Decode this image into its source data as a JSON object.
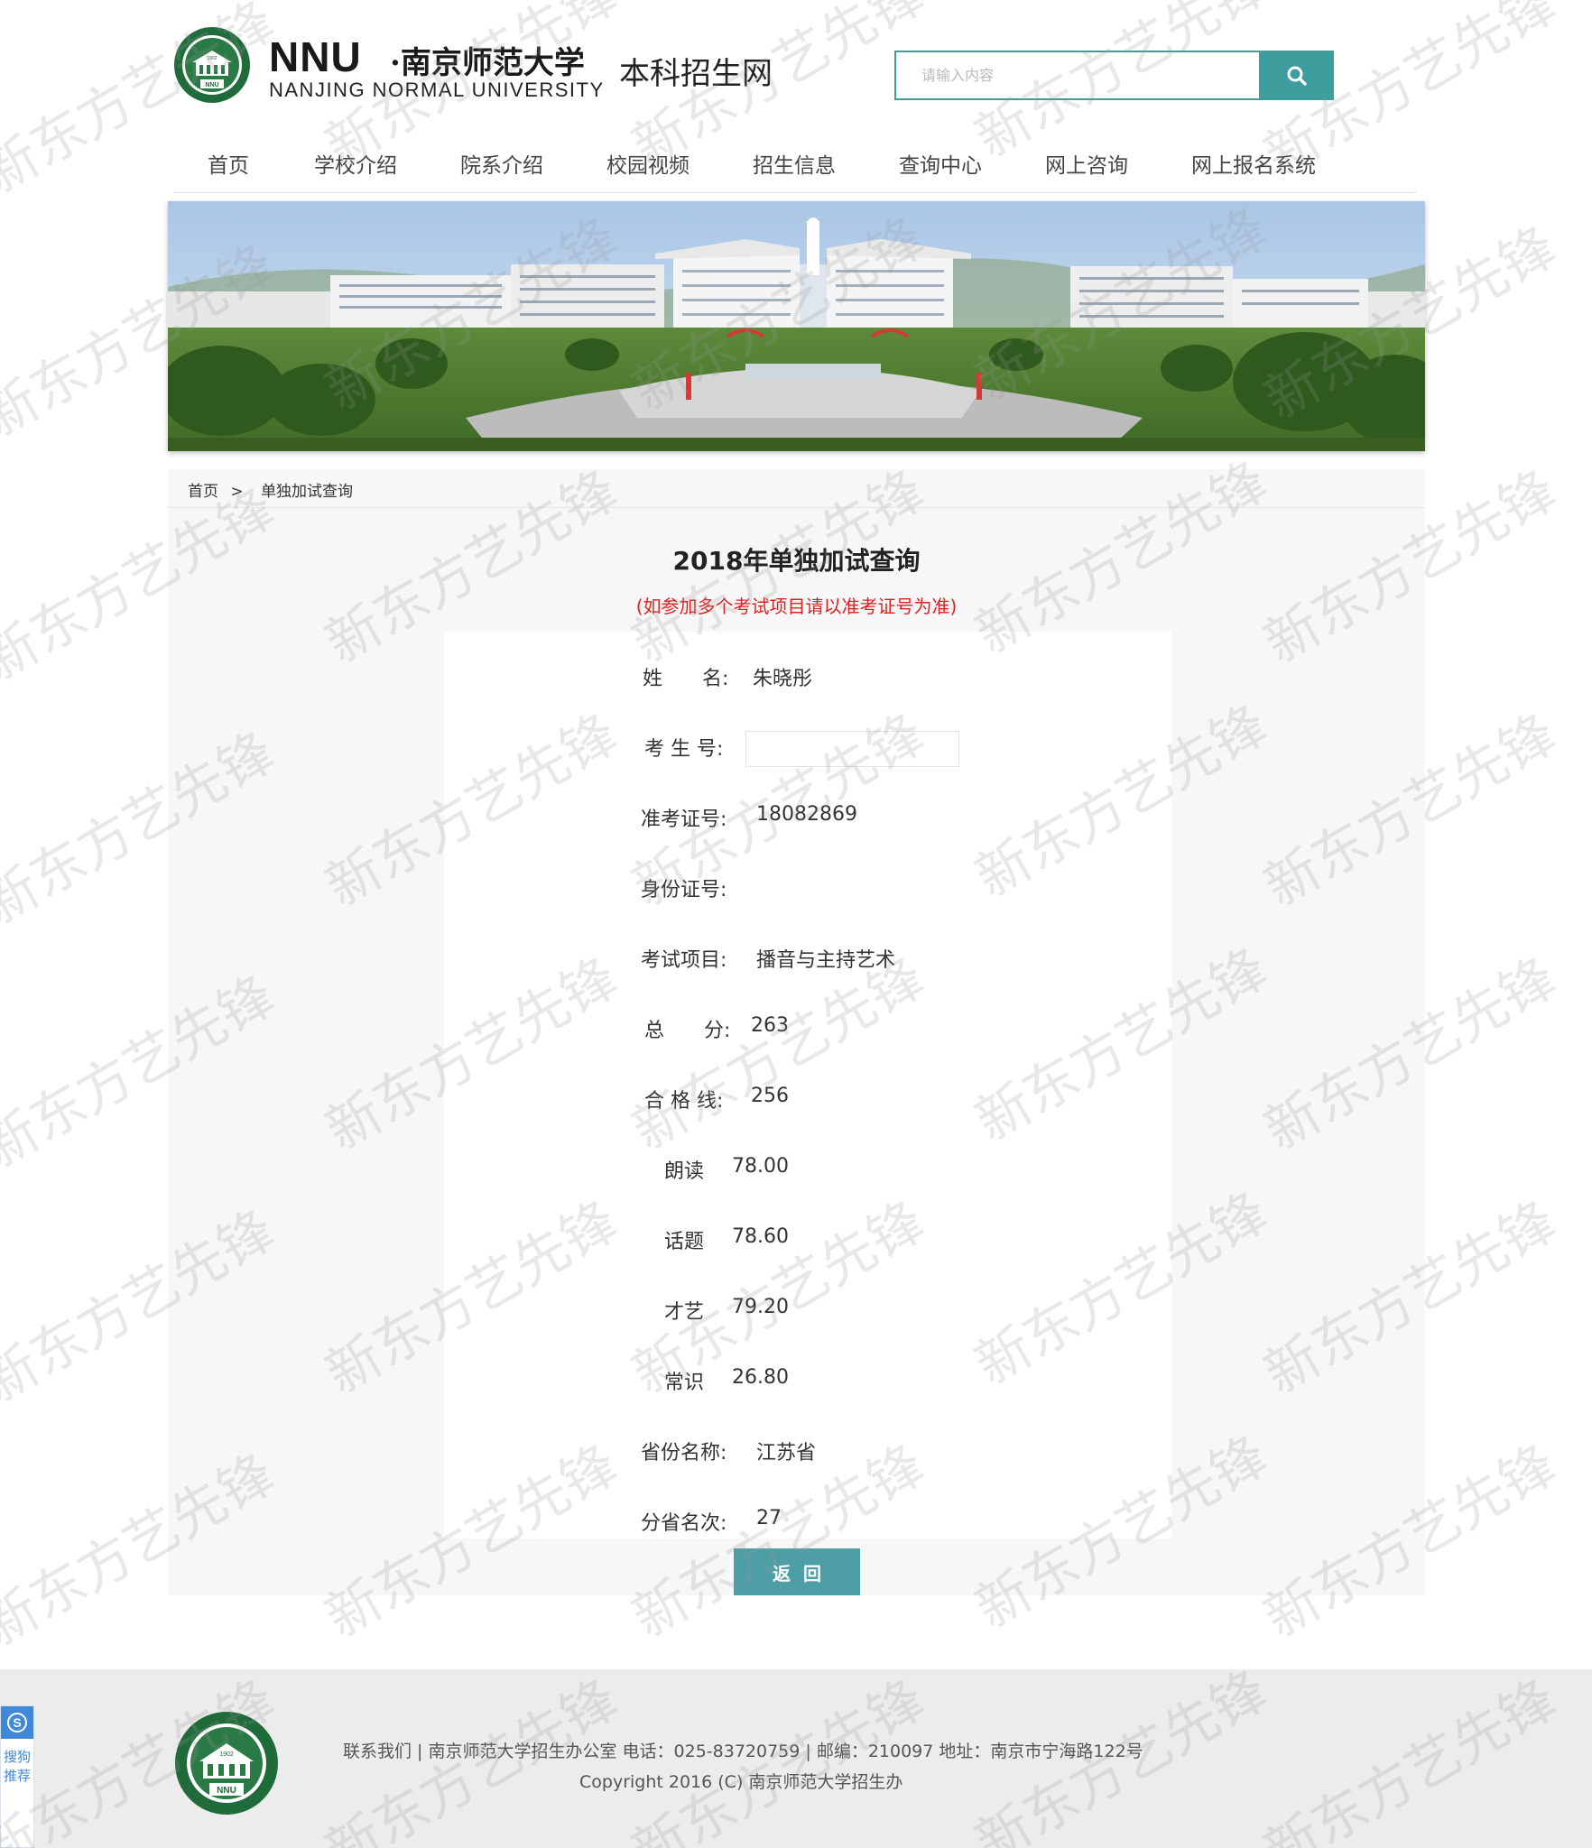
{
  "header": {
    "brand_en_big": "NNU",
    "brand_cn_script": "·南京师范大学",
    "brand_en_small": "NANJING NORMAL UNIVERSITY",
    "brand_sub": "本科招生网",
    "seal_text": "NNU",
    "seal_year": "1902",
    "search_placeholder": "请输入内容",
    "search_icon": "search-icon"
  },
  "nav": {
    "items": [
      {
        "label": "首页"
      },
      {
        "label": "学校介绍"
      },
      {
        "label": "院系介绍"
      },
      {
        "label": "校园视频"
      },
      {
        "label": "招生信息"
      },
      {
        "label": "查询中心"
      },
      {
        "label": "网上咨询"
      },
      {
        "label": "网上报名系统"
      }
    ]
  },
  "breadcrumb": {
    "home": "首页",
    "separator": ">",
    "current": "单独加试查询"
  },
  "result": {
    "title": "2018年单独加试查询",
    "note": "(如参加多个考试项目请以准考证号为准)",
    "rows": [
      {
        "label": "姓　　名:",
        "value": "朱晓彤"
      },
      {
        "label": "考 生 号:",
        "value": ""
      },
      {
        "label": "准考证号:",
        "value": "18082869"
      },
      {
        "label": "身份证号:",
        "value": ""
      },
      {
        "label": "考试项目:",
        "value": "播音与主持艺术"
      },
      {
        "label": "总　　分:",
        "value": "263"
      },
      {
        "label": "合 格 线:",
        "value": "256"
      },
      {
        "label": "朗读",
        "value": "78.00"
      },
      {
        "label": "话题",
        "value": "78.60"
      },
      {
        "label": "才艺",
        "value": "79.20"
      },
      {
        "label": "常识",
        "value": "26.80"
      },
      {
        "label": "省份名称:",
        "value": "江苏省"
      },
      {
        "label": "分省名次:",
        "value": "27"
      }
    ],
    "back_label": "返回"
  },
  "footer": {
    "line1": "联系我们 | 南京师范大学招生办公室 电话：025-83720759 | 邮编：210097 地址：南京市宁海路122号",
    "line2": "Copyright 2016 (C) 南京师范大学招生办",
    "seal_text": "NNU",
    "seal_year": "1902"
  },
  "side_tab": {
    "text": "搜狗推荐"
  },
  "watermark": {
    "text": "新东方艺先锋"
  },
  "colors": {
    "accent": "#3e9d9d",
    "button": "#4e9ea6",
    "note_red": "#e02020",
    "panel_bg": "#f7f7f7",
    "footer_bg": "#ececec"
  }
}
